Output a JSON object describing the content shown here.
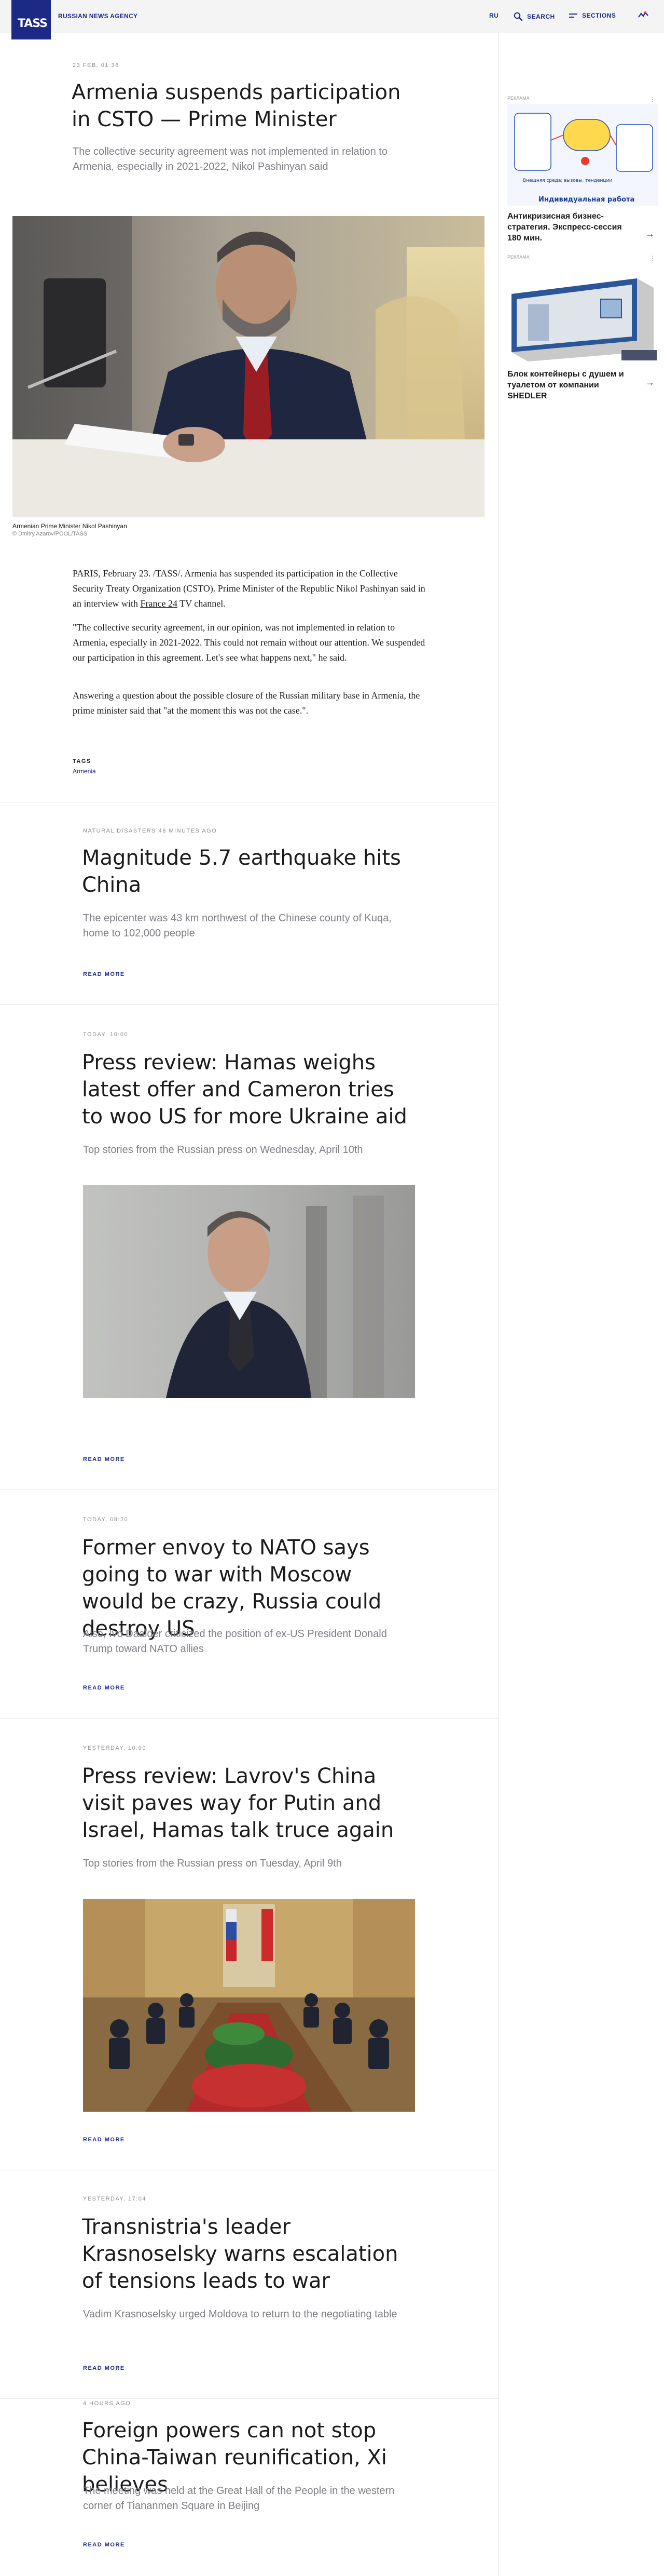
{
  "header": {
    "logo": "TASS",
    "agency": "RUSSIAN NEWS AGENCY",
    "lang": "RU",
    "search": "SEARCH",
    "sections": "SECTIONS"
  },
  "article": {
    "date": "23 FEB, 01:36",
    "title": "Armenia suspends participation in CSTO — Prime Minister",
    "lead": "The collective security agreement was not implemented in relation to Armenia, especially in 2021-2022, Nikol Pashinyan said",
    "photo_caption": "Armenian Prime Minister Nikol Pashinyan",
    "photo_credit": "© Dmitry Azarov/POOL/TASS",
    "p1_a": "PARIS, February 23. /TASS/. Armenia has suspended its participation in the Collective Security Treaty Organization (CSTO). Prime Minister of the Republic Nikol Pashinyan said in an interview with ",
    "p1_link": "France 24",
    "p1_b": " TV channel.",
    "p2": "\"The collective security agreement, in our opinion, was not implemented in relation to Armenia, especially in 2021-2022. This could not remain without our attention. We suspended our participation in this agreement. Let's see what happens next,\" he said.",
    "p3": "Answering a question about the possible closure of the Russian military base in Armenia, the prime minister said that \"at the moment this was not the case.\".",
    "tags_heading": "TAGS",
    "tag": "Armenia"
  },
  "feed": [
    {
      "meta": "NATURAL DISASTERS   48 MINUTES AGO",
      "title": "Magnitude 5.7 earthquake hits China",
      "lead": "The epicenter was 43 km northwest of the Chinese county of Kuqa, home to 102,000 people",
      "more": "READ MORE"
    },
    {
      "meta": "TODAY, 10:00",
      "title": "Press review: Hamas weighs latest offer and Cameron tries to woo US for more Ukraine aid",
      "lead": "Top stories from the Russian press on Wednesday, April 10th",
      "more": "READ MORE"
    },
    {
      "meta": "TODAY, 08:20",
      "title": "Former envoy to NATO says going to war with Moscow would be crazy, Russia could destroy US",
      "lead": "Also, Ivo Daalder criticized the position of ex-US President Donald Trump toward NATO allies",
      "more": "READ MORE"
    },
    {
      "meta": "YESTERDAY, 10:00",
      "title": "Press review: Lavrov's China visit paves way for Putin and Israel, Hamas talk truce again",
      "lead": "Top stories from the Russian press on Tuesday, April 9th",
      "more": "READ MORE"
    },
    {
      "meta": "YESTERDAY, 17:04",
      "title": "Transnistria's leader Krasnoselsky warns escalation of tensions leads to war",
      "lead": "Vadim Krasnoselsky urged Moldova to return to the negotiating table",
      "more": "READ MORE"
    },
    {
      "meta": "4 HOURS AGO",
      "title": "Foreign powers can not stop China-Taiwan reunification, Xi believes",
      "lead": "The meeting was held at the Great Hall of the People in the western corner of Tiananmen Square in Beijing",
      "more": "READ MORE"
    }
  ],
  "ads": [
    {
      "label": "РЕКЛАМА",
      "diagram_title": "Индивидуальная работа",
      "diagram_text": "Внешняя среда: вызовы, тенденции",
      "caption": "Антикризисная бизнес-стратегия. Экспресс-сессия 180 мин."
    },
    {
      "label": "РЕКЛАМА",
      "caption": "Блок контейнеры с душем и туалетом от компании SHEDLER"
    }
  ],
  "colors": {
    "brand": "#1d2a85",
    "meta": "#8b8b8b",
    "lead": "#7e7e86"
  }
}
